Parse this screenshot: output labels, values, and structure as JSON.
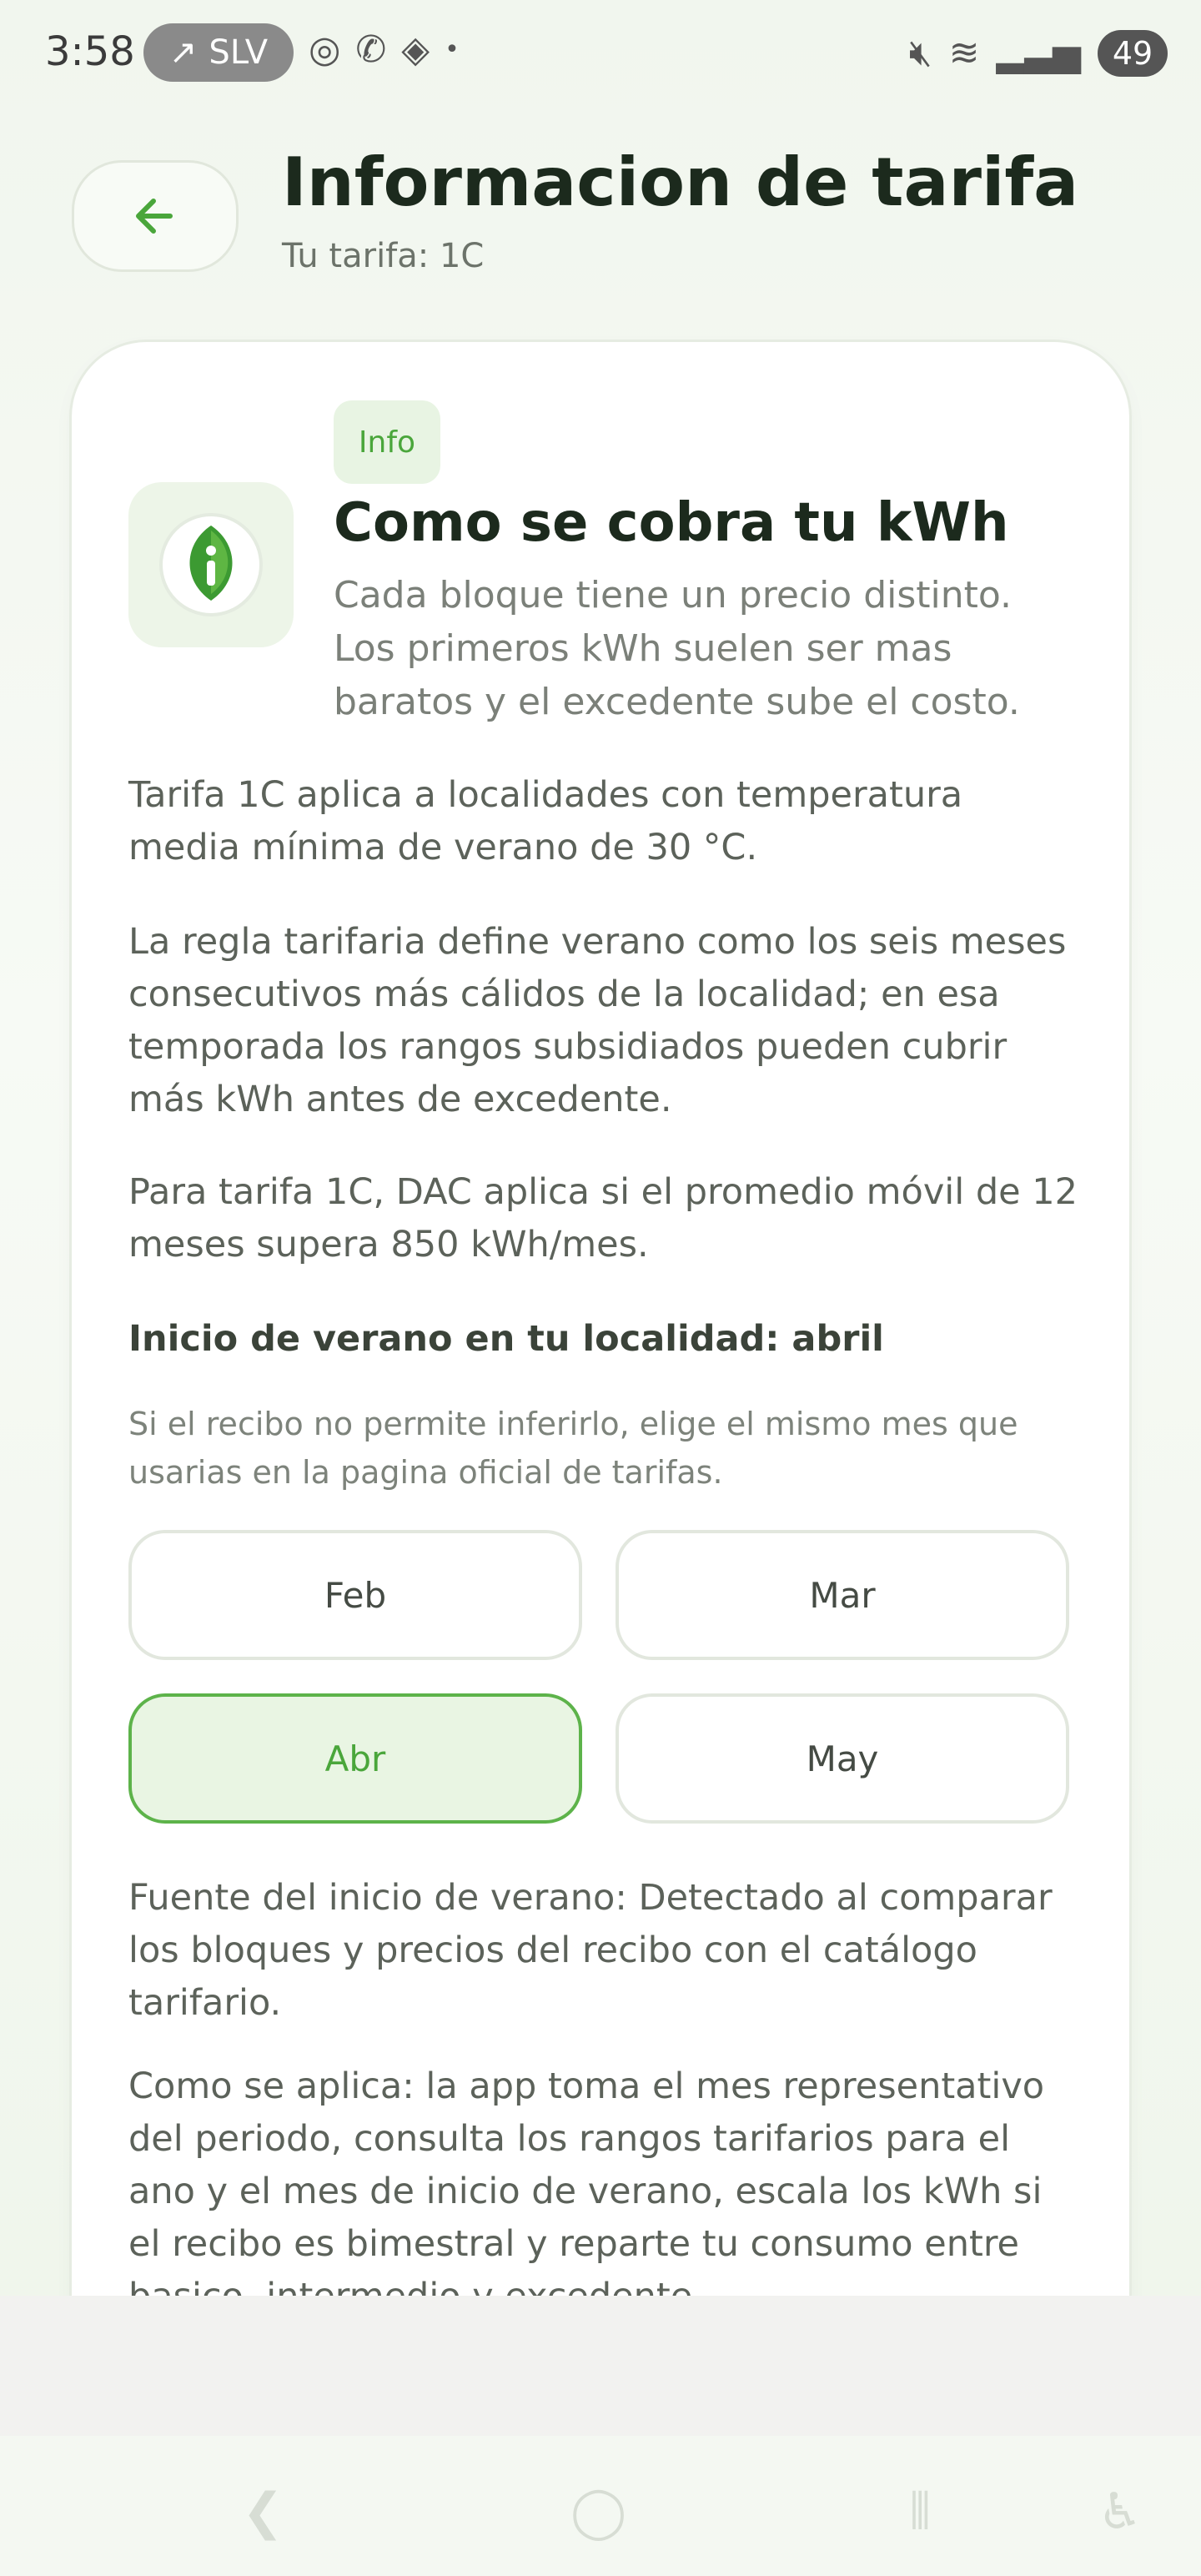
{
  "status_bar": {
    "time": "3:58",
    "carrier_pill": "SLV",
    "battery": "49"
  },
  "header": {
    "title": "Informacion de tarifa",
    "subtitle": "Tu tarifa: 1C"
  },
  "card": {
    "chip": "Info",
    "title": "Como se cobra tu kWh",
    "description": "Cada bloque tiene un precio distinto. Los primeros kWh suelen ser mas baratos y el excedente sube el costo.",
    "paragraphs": [
      "Tarifa 1C aplica a localidades con temperatura media mínima de verano de 30 °C.",
      "La regla tarifaria define verano como los seis meses consecutivos más cálidos de la localidad; en esa temporada los rangos subsidiados pueden cubrir más kWh antes de excedente.",
      "Para tarifa 1C, DAC aplica si el promedio móvil de 12 meses supera 850 kWh/mes."
    ],
    "summer_start_label": "Inicio de verano en tu localidad: abril",
    "hint": "Si el recibo no permite inferirlo, elige el mismo mes que usarias en la pagina oficial de tarifas.",
    "months": [
      "Feb",
      "Mar",
      "Abr",
      "May"
    ],
    "selected_month": "Abr",
    "source_text": "Fuente del inicio de verano: Detectado al comparar los bloques y precios del recibo con el catálogo tarifario.",
    "how_applied": "Como se aplica: la app toma el mes representativo del periodo, consulta los rangos tarifarios para el ano y el mes de inicio de verano, escala los kWh si el recibo es bimestral y reparte tu consumo entre basico, intermedio y excedente."
  },
  "colors": {
    "accent": "#4aa63b",
    "accent_bg": "#e9f5e3"
  }
}
